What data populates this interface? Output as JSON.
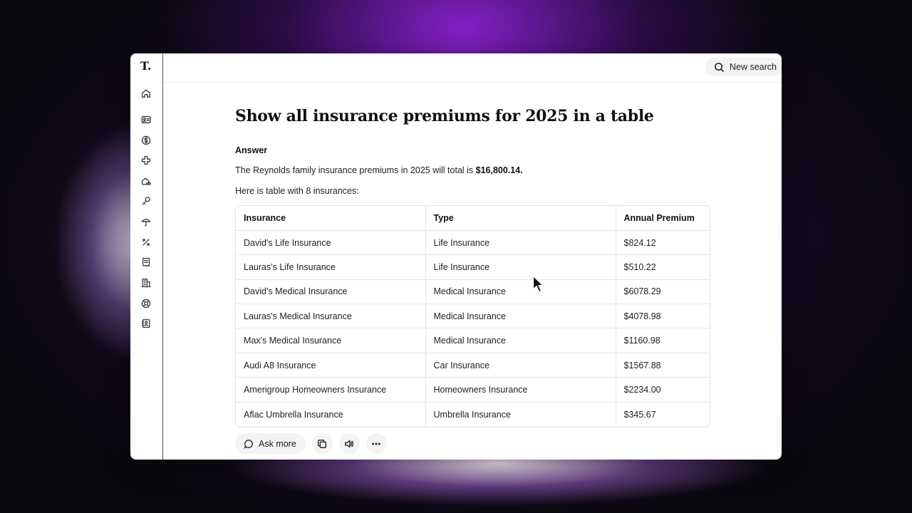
{
  "app": {
    "logo": "T."
  },
  "sidebar": {
    "items": [
      {
        "icon": "home-icon"
      },
      {
        "icon": "id-card-icon"
      },
      {
        "icon": "dollar-circle-icon"
      },
      {
        "icon": "medical-cross-icon"
      },
      {
        "icon": "house-car-icon"
      },
      {
        "icon": "key-icon"
      },
      {
        "icon": "umbrella-icon"
      },
      {
        "icon": "percent-icon"
      },
      {
        "icon": "receipt-icon"
      },
      {
        "icon": "building-icon"
      },
      {
        "icon": "lifebuoy-icon"
      },
      {
        "icon": "contact-book-icon"
      }
    ]
  },
  "topbar": {
    "new_search_label": "New search",
    "search_icon": "search-icon",
    "close_icon": "close-icon"
  },
  "main": {
    "question": "Show all insurance premiums for 2025 in a table",
    "answer_label": "Answer",
    "summary_prefix": "The Reynolds family insurance premiums in 2025 will total is ",
    "summary_total": "$16,800.14.",
    "intro": "Here is table with 8 insurances:",
    "table": {
      "headers": [
        "Insurance",
        "Type",
        "Annual Premium"
      ],
      "rows": [
        [
          "David's Life Insurance",
          "Life Insurance",
          "$824.12"
        ],
        [
          "Lauras's Life Insurance",
          "Life Insurance",
          "$510.22"
        ],
        [
          "David's Medical Insurance",
          "Medical Insurance",
          "$6078.29"
        ],
        [
          "Lauras's Medical Insurance",
          "Medical Insurance",
          "$4078.98"
        ],
        [
          "Max's Medical Insurance",
          "Medical Insurance",
          "$1160.98"
        ],
        [
          "Audi A8 Insurance",
          "Car Insurance",
          "$1567.88"
        ],
        [
          "Amerigroup Homeowners Insurance",
          "Homeowners Insurance",
          "$2234.00"
        ],
        [
          "Aflac Umbrella Insurance",
          "Umbrella Insurance",
          "$345.67"
        ]
      ]
    },
    "actions": {
      "ask_more_label": "Ask more",
      "buttons": [
        "copy-icon",
        "speaker-icon",
        "more-icon"
      ]
    }
  }
}
